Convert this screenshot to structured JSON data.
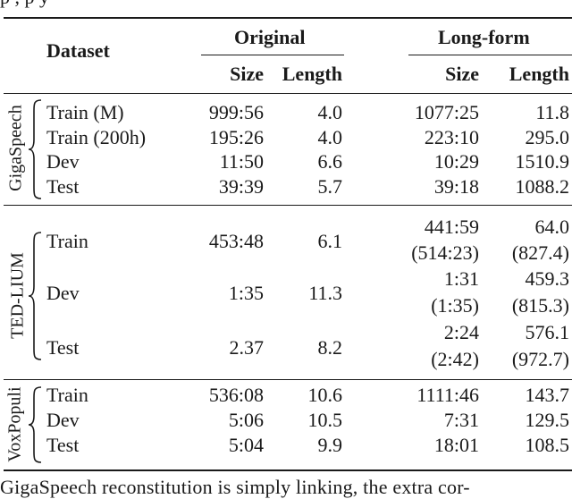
{
  "caption_fragment_top": "              p                         ,    p             y",
  "body_text_bottom": "GigaSpeech reconstitution is simply linking, the extra cor-",
  "table": {
    "header": {
      "dataset": "Dataset",
      "groups": [
        "Original",
        "Long-form"
      ],
      "subcolumns": [
        "Size",
        "Length",
        "Size",
        "Length"
      ]
    },
    "sections": [
      {
        "name": "GigaSpeech",
        "rows": [
          {
            "split": "Train (M)",
            "orig_size": "999:56",
            "orig_length": "4.0",
            "lf_size": "1077:25",
            "lf_length": "11.8"
          },
          {
            "split": "Train (200h)",
            "orig_size": "195:26",
            "orig_length": "4.0",
            "lf_size": "223:10",
            "lf_length": "295.0"
          },
          {
            "split": "Dev",
            "orig_size": "11:50",
            "orig_length": "6.6",
            "lf_size": "10:29",
            "lf_length": "1510.9"
          },
          {
            "split": "Test",
            "orig_size": "39:39",
            "orig_length": "5.7",
            "lf_size": "39:18",
            "lf_length": "1088.2"
          }
        ]
      },
      {
        "name": "TED-LIUM",
        "rows": [
          {
            "split": "Train",
            "orig_size": "453:48",
            "orig_length": "6.1",
            "lf_size": "441:59",
            "lf_length": "64.0",
            "lf_size_alt": "(514:23)",
            "lf_length_alt": "(827.4)"
          },
          {
            "split": "Dev",
            "orig_size": "1:35",
            "orig_length": "11.3",
            "lf_size": "1:31",
            "lf_length": "459.3",
            "lf_size_alt": "(1:35)",
            "lf_length_alt": "(815.3)"
          },
          {
            "split": "Test",
            "orig_size": "2.37",
            "orig_length": "8.2",
            "lf_size": "2:24",
            "lf_length": "576.1",
            "lf_size_alt": "(2:42)",
            "lf_length_alt": "(972.7)"
          }
        ]
      },
      {
        "name": "VoxPopuli",
        "rows": [
          {
            "split": "Train",
            "orig_size": "536:08",
            "orig_length": "10.6",
            "lf_size": "1111:46",
            "lf_length": "143.7"
          },
          {
            "split": "Dev",
            "orig_size": "5:06",
            "orig_length": "10.5",
            "lf_size": "7:31",
            "lf_length": "129.5"
          },
          {
            "split": "Test",
            "orig_size": "5:04",
            "orig_length": "9.9",
            "lf_size": "18:01",
            "lf_length": "108.5"
          }
        ]
      }
    ]
  }
}
